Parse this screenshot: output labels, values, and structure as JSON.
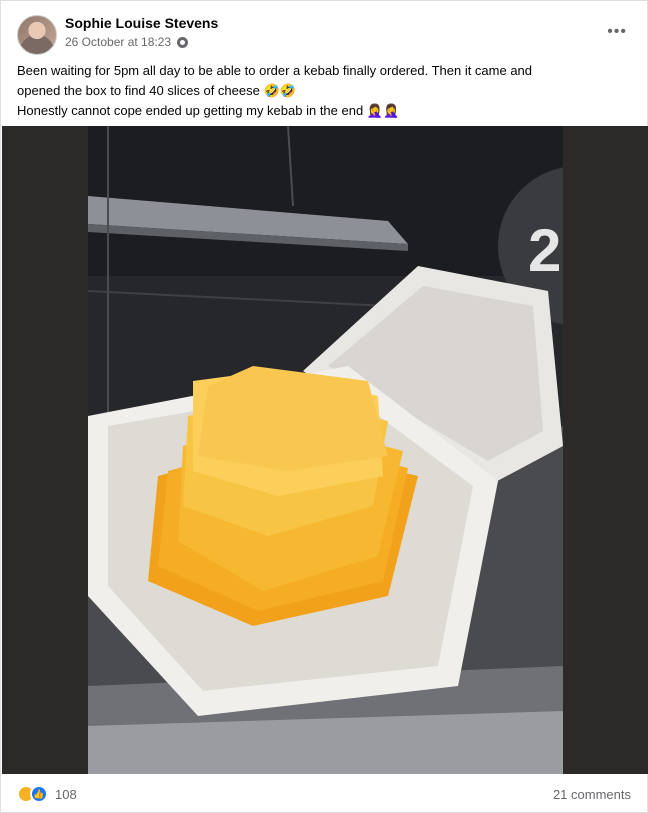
{
  "post": {
    "author": "Sophie Louise Stevens",
    "timestamp": "26 October at 18:23",
    "audience_icon": "globe-icon",
    "more_icon": "more-options-icon",
    "text_lines": [
      "Been waiting for 5pm all day to be able to order a kebab finally ordered. Then it came and",
      "opened the box to find 40 slices of cheese 🤣🤣",
      "Honestly cannot cope ended up getting my kebab in the end 🤦‍♀️🤦‍♀️"
    ]
  },
  "footer": {
    "reaction_count": "108",
    "reaction_icons": [
      "haha-icon",
      "like-icon"
    ],
    "comments": "21 comments"
  }
}
